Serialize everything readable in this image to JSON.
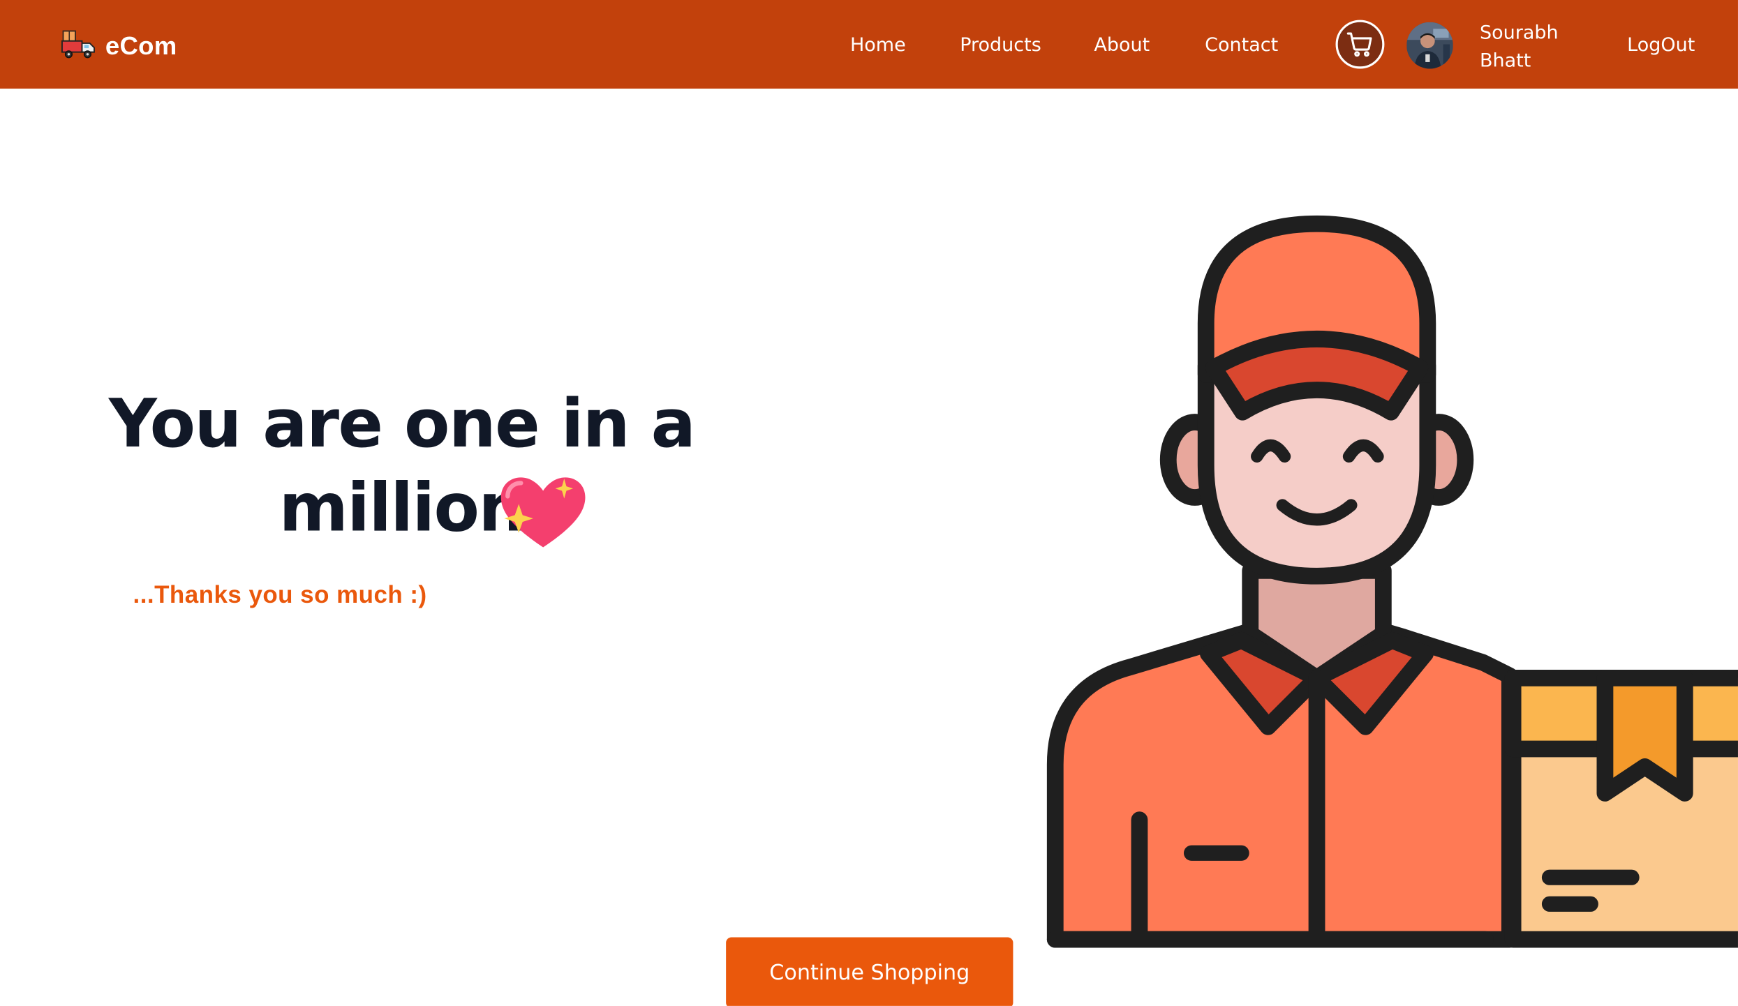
{
  "app": {
    "brand_name": "eCom",
    "brand_icon": "delivery-truck-icon"
  },
  "nav": {
    "links": [
      {
        "label": "Home"
      },
      {
        "label": "Products"
      },
      {
        "label": "About"
      },
      {
        "label": "Contact"
      }
    ],
    "cart_icon": "shopping-cart-icon",
    "user": {
      "name": "Sourabh Bhatt",
      "avatar": "user-avatar-photo"
    },
    "logout_label": "LogOut"
  },
  "hero": {
    "title": "You are one in a million",
    "title_emoji": "sparkling-heart-icon",
    "subtitle": "...Thanks you so much :)",
    "illustration": "delivery-man-with-box-illustration",
    "cta_label": "Continue Shopping"
  },
  "colors": {
    "navbar_bg": "#c2410c",
    "accent": "#ea580c",
    "heading": "#111827",
    "white": "#ffffff"
  }
}
